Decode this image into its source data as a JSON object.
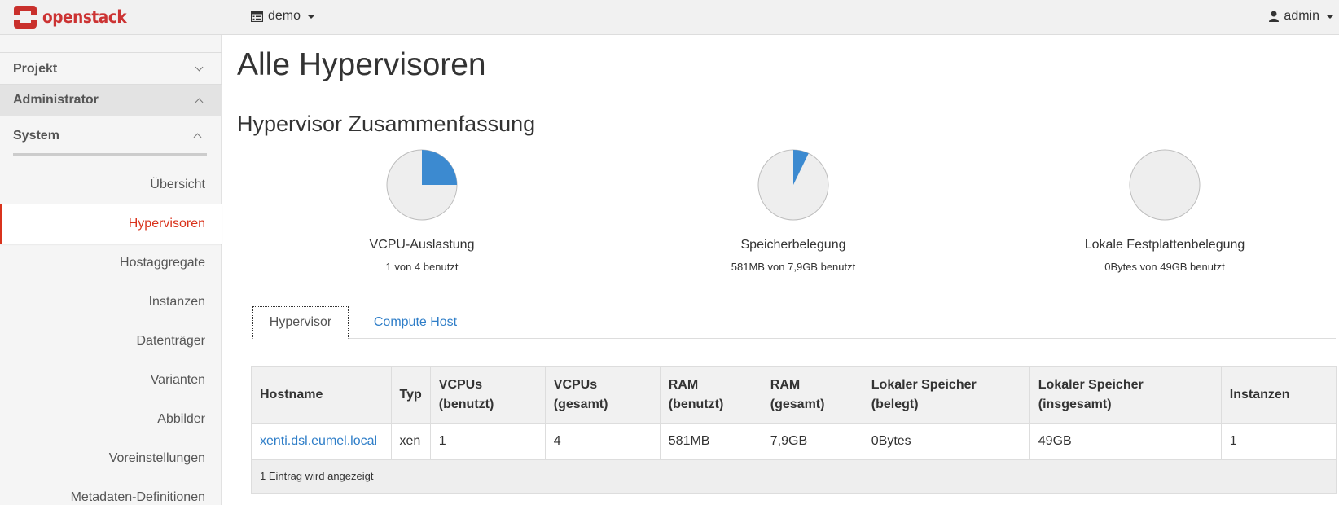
{
  "topbar": {
    "logo_text": "openstack",
    "project": "demo",
    "user": "admin"
  },
  "sidebar": {
    "sections": [
      {
        "label": "Projekt"
      },
      {
        "label": "Administrator"
      }
    ],
    "subsection": "System",
    "items": [
      {
        "label": "Übersicht"
      },
      {
        "label": "Hypervisoren"
      },
      {
        "label": "Hostaggregate"
      },
      {
        "label": "Instanzen"
      },
      {
        "label": "Datenträger"
      },
      {
        "label": "Varianten"
      },
      {
        "label": "Abbilder"
      },
      {
        "label": "Voreinstellungen"
      },
      {
        "label": "Metadaten-Definitionen"
      }
    ],
    "active_item": "Hypervisoren"
  },
  "main": {
    "title": "Alle Hypervisoren",
    "summary_title": "Hypervisor Zusammenfassung"
  },
  "charts": [
    {
      "label": "VCPU-Auslastung",
      "usage": "1 von 4 benutzt",
      "fraction": 0.25
    },
    {
      "label": "Speicherbelegung",
      "usage": "581MB von 7,9GB benutzt",
      "fraction": 0.0718
    },
    {
      "label": "Lokale Festplattenbelegung",
      "usage": "0Bytes von 49GB benutzt",
      "fraction": 0
    }
  ],
  "colors": {
    "pie_used": "#3c8ad0",
    "pie_free": "#eeeeee",
    "accent": "#d9331c",
    "link": "#2f7ec8"
  },
  "tabs": [
    {
      "label": "Hypervisor"
    },
    {
      "label": "Compute Host"
    }
  ],
  "table": {
    "headers": [
      [
        "Hostname",
        ""
      ],
      [
        "Typ",
        ""
      ],
      [
        "VCPUs",
        "(benutzt)"
      ],
      [
        "VCPUs",
        "(gesamt)"
      ],
      [
        "RAM",
        "(benutzt)"
      ],
      [
        "RAM",
        "(gesamt)"
      ],
      [
        "Lokaler Speicher",
        "(belegt)"
      ],
      [
        "Lokaler Speicher",
        "(insgesamt)"
      ],
      [
        "Instanzen",
        ""
      ]
    ],
    "rows": [
      [
        "xenti.dsl.eumel.local",
        "xen",
        "1",
        "4",
        "581MB",
        "7,9GB",
        "0Bytes",
        "49GB",
        "1"
      ]
    ],
    "footer": "1 Eintrag wird angezeigt"
  }
}
